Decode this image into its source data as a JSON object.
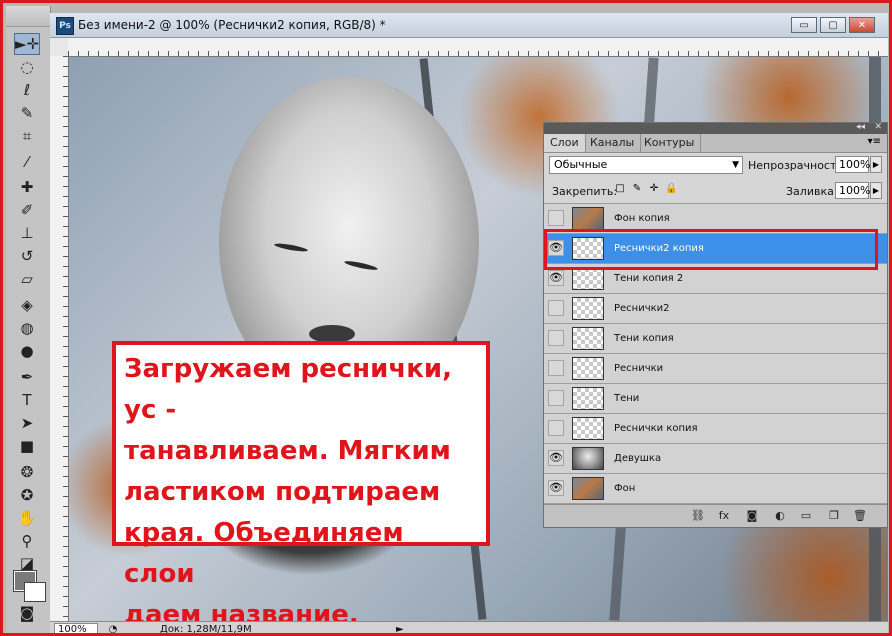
{
  "document": {
    "title": "Без имени-2 @ 100% (Реснички2 копия, RGB/8) *",
    "app_badge": "Ps",
    "window_buttons": {
      "minimize": "▭",
      "restore": "▢",
      "close": "✕"
    }
  },
  "toolbar": {
    "tools": [
      {
        "name": "move-tool-icon",
        "glyph": "►✛"
      },
      {
        "name": "marquee-tool-icon",
        "glyph": "◌"
      },
      {
        "name": "lasso-tool-icon",
        "glyph": "ℓ"
      },
      {
        "name": "quick-select-tool-icon",
        "glyph": "✎"
      },
      {
        "name": "crop-tool-icon",
        "glyph": "⌗"
      },
      {
        "name": "eyedropper-tool-icon",
        "glyph": "⁄"
      },
      {
        "name": "healing-brush-tool-icon",
        "glyph": "✚"
      },
      {
        "name": "brush-tool-icon",
        "glyph": "✐"
      },
      {
        "name": "clone-stamp-tool-icon",
        "glyph": "⊥"
      },
      {
        "name": "history-brush-tool-icon",
        "glyph": "↺"
      },
      {
        "name": "eraser-tool-icon",
        "glyph": "▱"
      },
      {
        "name": "paint-bucket-tool-icon",
        "glyph": "◈"
      },
      {
        "name": "blur-tool-icon",
        "glyph": "◍"
      },
      {
        "name": "dodge-tool-icon",
        "glyph": "●"
      },
      {
        "name": "pen-tool-icon",
        "glyph": "✒"
      },
      {
        "name": "type-tool-icon",
        "glyph": "T"
      },
      {
        "name": "path-select-tool-icon",
        "glyph": "➤"
      },
      {
        "name": "shape-tool-icon",
        "glyph": "■"
      },
      {
        "name": "3d-rotate-tool-icon",
        "glyph": "❂"
      },
      {
        "name": "3d-orbit-tool-icon",
        "glyph": "✪"
      },
      {
        "name": "hand-tool-icon",
        "glyph": "✋"
      },
      {
        "name": "zoom-tool-icon",
        "glyph": "⚲"
      },
      {
        "name": "default-colors-icon",
        "glyph": "◪"
      },
      {
        "name": "quick-mask-icon",
        "glyph": "◙"
      }
    ]
  },
  "caption": {
    "text": "Загружаем реснички, ус -\nтанавливаем. Мягким\nластиком подтираем\nкрая. Объединяем слои\nдаем название."
  },
  "statusbar": {
    "zoom": "100%",
    "doc_size": "Док: 1,28M/11,9M",
    "arrow": "►"
  },
  "layers_panel": {
    "collapse_icons": "◂◂",
    "close_icon": "✕",
    "tabs": [
      "Слои",
      "Каналы",
      "Контуры"
    ],
    "menu_icon": "▾≡",
    "blend_mode": "Обычные",
    "opacity_label": "Непрозрачность:",
    "opacity_value": "100%",
    "lock_label": "Закрепить:",
    "lock_icons": [
      "□",
      "✎",
      "✛",
      "🔒"
    ],
    "fill_label": "Заливка:",
    "fill_value": "100%",
    "layers": [
      {
        "name": "Фон копия",
        "visible": false,
        "thumb": "img",
        "selected": false
      },
      {
        "name": "Реснички2 копия",
        "visible": true,
        "thumb": "transparent",
        "selected": true
      },
      {
        "name": "Тени копия 2",
        "visible": true,
        "thumb": "transparent",
        "selected": false
      },
      {
        "name": "Реснички2",
        "visible": false,
        "thumb": "transparent",
        "selected": false
      },
      {
        "name": "Тени копия",
        "visible": false,
        "thumb": "transparent",
        "selected": false
      },
      {
        "name": "Реснички",
        "visible": false,
        "thumb": "transparent",
        "selected": false
      },
      {
        "name": "Тени",
        "visible": false,
        "thumb": "transparent",
        "selected": false
      },
      {
        "name": "Реснички копия",
        "visible": false,
        "thumb": "transparent",
        "selected": false
      },
      {
        "name": "Девушка",
        "visible": true,
        "thumb": "girl",
        "selected": false
      },
      {
        "name": "Фон",
        "visible": true,
        "thumb": "img",
        "selected": false
      }
    ],
    "eye_glyph": "👁",
    "bottom_icons": [
      {
        "name": "link-layers-icon",
        "glyph": "⛓"
      },
      {
        "name": "layer-style-icon",
        "glyph": "fx"
      },
      {
        "name": "add-mask-icon",
        "glyph": "◙"
      },
      {
        "name": "adjustment-layer-icon",
        "glyph": "◐"
      },
      {
        "name": "new-group-icon",
        "glyph": "▭"
      },
      {
        "name": "new-layer-icon",
        "glyph": "❐"
      },
      {
        "name": "delete-layer-icon",
        "glyph": "🗑"
      }
    ]
  },
  "colors": {
    "accent_red": "#e0141b",
    "selection_blue": "#3d8fe7"
  }
}
